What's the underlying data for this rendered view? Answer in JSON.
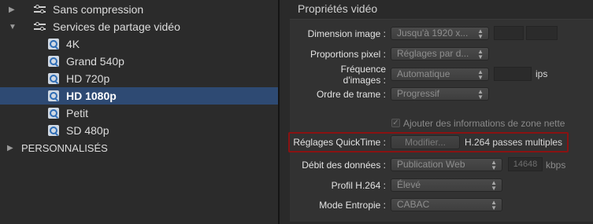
{
  "sidebar": {
    "items": [
      {
        "label": "Sans compression",
        "icon": "sliders-icon"
      },
      {
        "label": "Services de partage vidéo",
        "icon": "sliders-icon",
        "expanded": true
      },
      {
        "label": "4K",
        "icon": "quicktime-icon"
      },
      {
        "label": "Grand 540p",
        "icon": "quicktime-icon"
      },
      {
        "label": "HD 720p",
        "icon": "quicktime-icon"
      },
      {
        "label": "HD 1080p",
        "icon": "quicktime-icon",
        "selected": true
      },
      {
        "label": "Petit",
        "icon": "quicktime-icon"
      },
      {
        "label": "SD 480p",
        "icon": "quicktime-icon"
      },
      {
        "label": "PERSONNALISÉS"
      }
    ]
  },
  "video": {
    "section_title": "Propriétés vidéo",
    "dimension": {
      "label": "Dimension image :",
      "value": "Jusqu'à 1920 x..."
    },
    "pixel": {
      "label": "Proportions pixel :",
      "value": "Réglages par d..."
    },
    "framerate": {
      "label_line1": "Fréquence",
      "label_line2": "d'images :",
      "value": "Automatique",
      "unit": "ips"
    },
    "field_order": {
      "label": "Ordre de trame :",
      "value": "Progressif"
    },
    "clean_aperture": {
      "label": "Ajouter des informations de zone nette",
      "checked": true
    },
    "quicktime": {
      "label": "Réglages QuickTime :",
      "button": "Modifier...",
      "value": "H.264 passes multiples"
    },
    "data_rate": {
      "label": "Débit des données :",
      "value": "Publication Web",
      "number": "14648",
      "unit": "kbps"
    },
    "h264_profile": {
      "label": "Profil H.264 :",
      "value": "Élevé"
    },
    "entropy": {
      "label": "Mode Entropie :",
      "value": "CABAC"
    }
  },
  "colors": {
    "selection": "#2e4a73",
    "highlight_border": "#8a1212"
  }
}
